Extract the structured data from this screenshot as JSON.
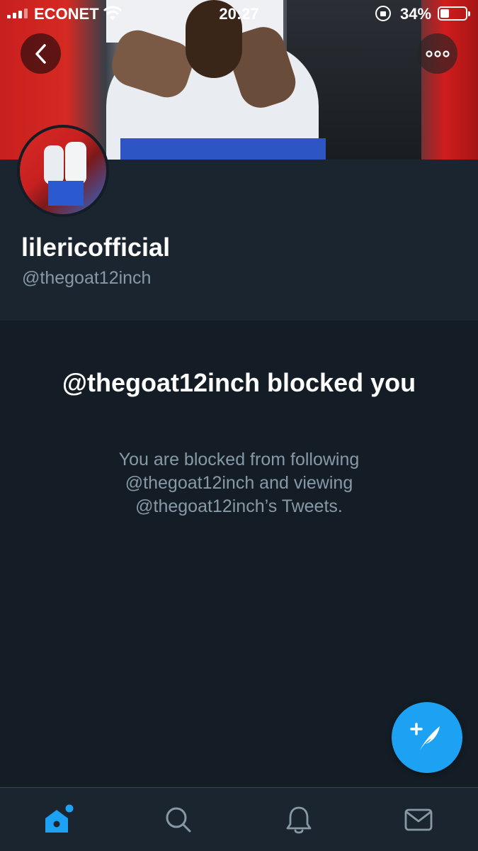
{
  "status_bar": {
    "carrier": "ECONET",
    "time": "20:27",
    "battery_percent": "34%"
  },
  "header": {
    "back_icon": "chevron-left-icon",
    "more_icon": "more-horizontal-icon"
  },
  "profile": {
    "display_name": "lilericofficial",
    "handle": "@thegoat12inch"
  },
  "blocked": {
    "title": "@thegoat12inch blocked you",
    "description": "You are blocked from following @thegoat12inch and viewing @thegoat12inch’s Tweets."
  },
  "fab": {
    "icon": "compose-tweet-icon"
  },
  "bottom_nav": {
    "items": [
      {
        "name": "home",
        "icon": "home-icon",
        "active": true,
        "has_notification_dot": true
      },
      {
        "name": "search",
        "icon": "search-icon",
        "active": false
      },
      {
        "name": "notifications",
        "icon": "bell-icon",
        "active": false
      },
      {
        "name": "messages",
        "icon": "mail-icon",
        "active": false
      }
    ]
  },
  "colors": {
    "background": "#141d26",
    "surface": "#1b252f",
    "accent": "#1da1f2",
    "secondary_text": "#8899a6",
    "icon_inactive": "#8899a6"
  }
}
